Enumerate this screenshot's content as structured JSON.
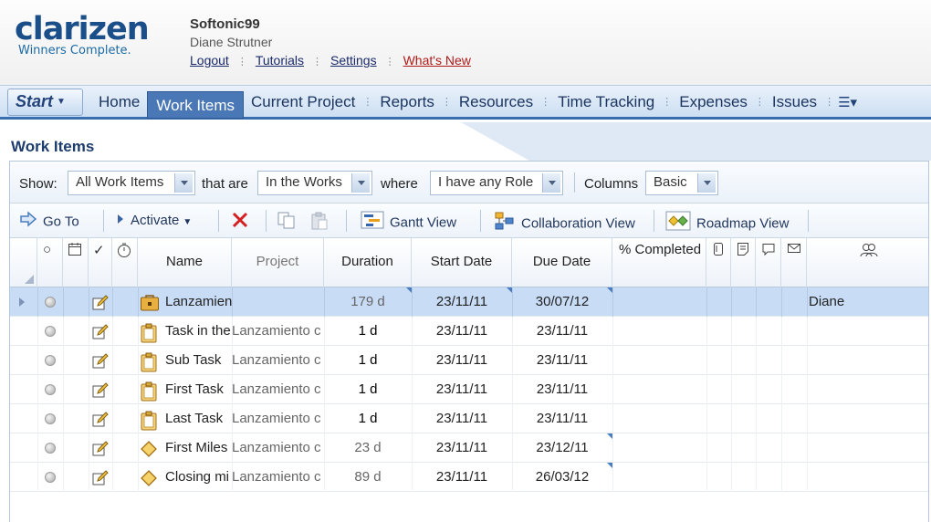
{
  "header": {
    "logo_text": "clarizen",
    "logo_tagline": "Winners Complete.",
    "company": "Softonic99",
    "user": "Diane Strutner",
    "links": [
      {
        "label": "Logout"
      },
      {
        "label": "Tutorials"
      },
      {
        "label": "Settings"
      },
      {
        "label": "What's New"
      }
    ]
  },
  "nav": {
    "start_label": "Start",
    "items": [
      {
        "label": "Home"
      },
      {
        "label": "Work Items",
        "active": true
      },
      {
        "label": "Current Project"
      },
      {
        "label": "Reports"
      },
      {
        "label": "Resources"
      },
      {
        "label": "Time Tracking"
      },
      {
        "label": "Expenses"
      },
      {
        "label": "Issues"
      }
    ]
  },
  "page_title": "Work Items",
  "filters": {
    "show_label": "Show:",
    "show_value": "All Work Items",
    "that_are_label": "that are",
    "that_are_value": "In the Works",
    "where_label": "where",
    "where_value": "I have any Role",
    "columns_label": "Columns",
    "columns_value": "Basic"
  },
  "toolbar": {
    "goto_label": "Go To",
    "activate_label": "Activate",
    "gantt_label": "Gantt View",
    "collab_label": "Collaboration View",
    "roadmap_label": "Roadmap View"
  },
  "columns": {
    "name": "Name",
    "project": "Project",
    "duration": "Duration",
    "start_date": "Start Date",
    "due_date": "Due Date",
    "completed": "% Completed"
  },
  "rows": [
    {
      "name": "Lanzamiento",
      "project": "",
      "duration": "179 d",
      "start": "23/11/11",
      "due": "30/07/12",
      "owner": "Diane",
      "type": "project"
    },
    {
      "name": "Task in the",
      "project": "Lanzamiento c",
      "duration": "1 d",
      "start": "23/11/11",
      "due": "23/11/11",
      "owner": "",
      "type": "task"
    },
    {
      "name": "Sub Task",
      "project": "Lanzamiento c",
      "duration": "1 d",
      "start": "23/11/11",
      "due": "23/11/11",
      "owner": "",
      "type": "task"
    },
    {
      "name": "First Task",
      "project": "Lanzamiento c",
      "duration": "1 d",
      "start": "23/11/11",
      "due": "23/11/11",
      "owner": "",
      "type": "task"
    },
    {
      "name": "Last Task",
      "project": "Lanzamiento c",
      "duration": "1 d",
      "start": "23/11/11",
      "due": "23/11/11",
      "owner": "",
      "type": "task"
    },
    {
      "name": "First Miles",
      "project": "Lanzamiento c",
      "duration": "23 d",
      "start": "23/11/11",
      "due": "23/12/11",
      "owner": "",
      "type": "milestone"
    },
    {
      "name": "Closing mi",
      "project": "Lanzamiento c",
      "duration": "89 d",
      "start": "23/11/11",
      "due": "26/03/12",
      "owner": "",
      "type": "milestone"
    }
  ]
}
